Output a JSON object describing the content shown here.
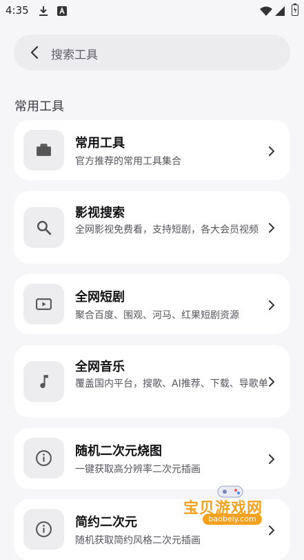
{
  "status_bar": {
    "time": "4:35"
  },
  "search": {
    "placeholder": "搜索工具"
  },
  "section": {
    "title": "常用工具"
  },
  "cards": [
    {
      "title": "常用工具",
      "desc": "官方推荐的常用工具集合",
      "icon": "briefcase-icon"
    },
    {
      "title": "影视搜索",
      "desc": "全网影视免费看，支持短剧，各大会员视频",
      "icon": "search-icon"
    },
    {
      "title": "全网短剧",
      "desc": "聚合百度、围观、河马、红果短剧资源",
      "icon": "play-video-icon"
    },
    {
      "title": "全网音乐",
      "desc": "覆盖国内平台，搜歌、AI推荐、下载、导歌单",
      "icon": "music-note-icon"
    },
    {
      "title": "随机二次元烧图",
      "desc": "一键获取高分辨率二次元插画",
      "icon": "info-icon"
    },
    {
      "title": "简约二次元",
      "desc": "随机获取简约风格二次元插画",
      "icon": "info-icon"
    }
  ],
  "watermark": {
    "text": "宝贝游戏网",
    "url": "baobeiy.com"
  }
}
